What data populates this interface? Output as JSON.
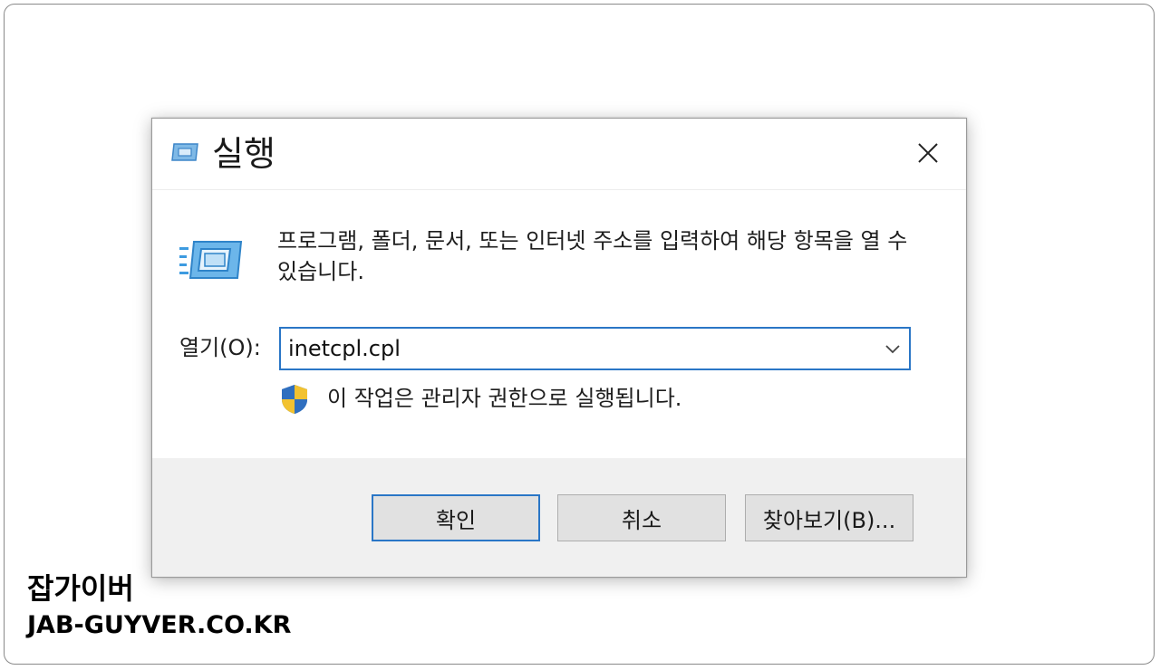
{
  "dialog": {
    "title": "실행",
    "icon": "run-icon",
    "close_icon": "close-icon",
    "description": "프로그램, 폴더, 문서, 또는 인터넷 주소를 입력하여 해당 항목을 열 수 있습니다.",
    "open_label": "열기(O):",
    "open_value": "inetcpl.cpl",
    "dropdown_icon": "chevron-down-icon",
    "admin_icon": "uac-shield-icon",
    "admin_note": "이 작업은 관리자 권한으로 실행됩니다.",
    "buttons": {
      "ok": "확인",
      "cancel": "취소",
      "browse": "찾아보기(B)..."
    }
  },
  "watermark": {
    "line1": "잡가이버",
    "line2": "JAB-GUYVER.CO.KR"
  },
  "colors": {
    "accent": "#2a76c6",
    "footer_bg": "#f0f0f0",
    "button_bg": "#e1e1e1"
  }
}
